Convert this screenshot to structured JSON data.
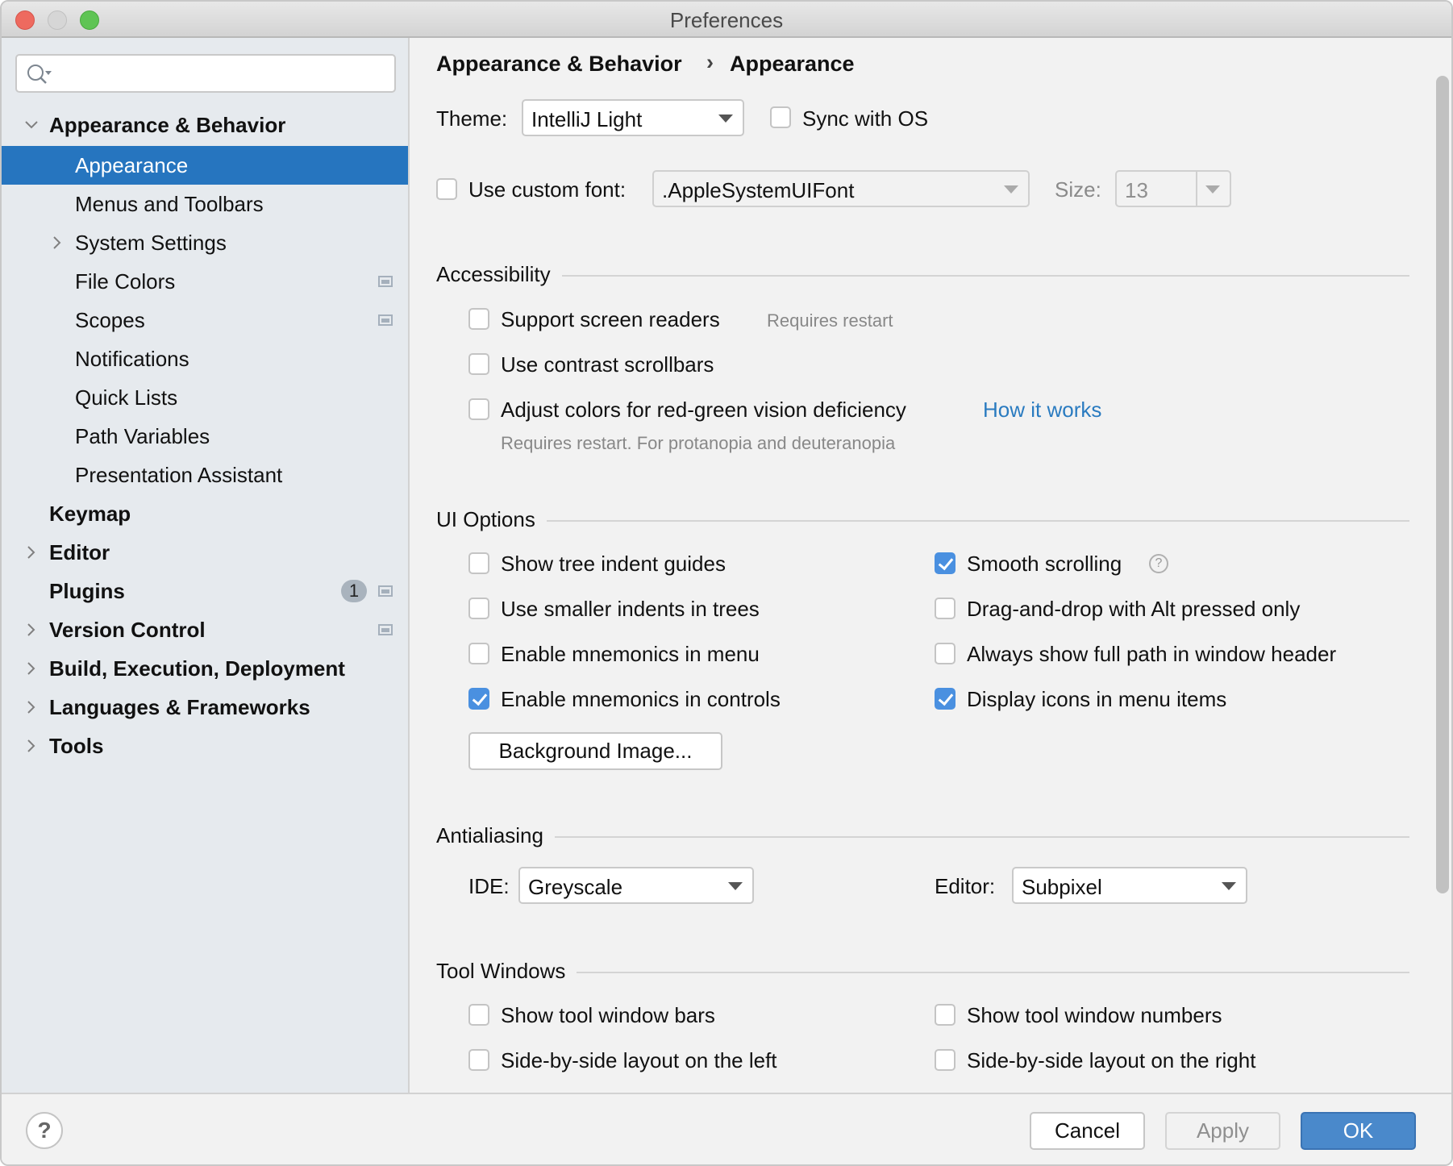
{
  "window": {
    "title": "Preferences"
  },
  "sidebar": {
    "search": {
      "placeholder": "",
      "value": ""
    },
    "items": [
      {
        "label": "Appearance & Behavior",
        "level": 0,
        "bold": true,
        "expander": "expanded"
      },
      {
        "label": "Appearance",
        "level": 1,
        "bold": false,
        "selected": true
      },
      {
        "label": "Menus and Toolbars",
        "level": 1,
        "bold": false
      },
      {
        "label": "System Settings",
        "level": 1,
        "bold": false,
        "expander": "collapsed"
      },
      {
        "label": "File Colors",
        "level": 1,
        "bold": false,
        "project_icon": true
      },
      {
        "label": "Scopes",
        "level": 1,
        "bold": false,
        "project_icon": true
      },
      {
        "label": "Notifications",
        "level": 1,
        "bold": false
      },
      {
        "label": "Quick Lists",
        "level": 1,
        "bold": false
      },
      {
        "label": "Path Variables",
        "level": 1,
        "bold": false
      },
      {
        "label": "Presentation Assistant",
        "level": 1,
        "bold": false
      },
      {
        "label": "Keymap",
        "level": 0,
        "bold": true
      },
      {
        "label": "Editor",
        "level": 0,
        "bold": true,
        "expander": "collapsed"
      },
      {
        "label": "Plugins",
        "level": 0,
        "bold": true,
        "badge": "1",
        "project_icon": true
      },
      {
        "label": "Version Control",
        "level": 0,
        "bold": true,
        "expander": "collapsed",
        "project_icon": true
      },
      {
        "label": "Build, Execution, Deployment",
        "level": 0,
        "bold": true,
        "expander": "collapsed"
      },
      {
        "label": "Languages & Frameworks",
        "level": 0,
        "bold": true,
        "expander": "collapsed"
      },
      {
        "label": "Tools",
        "level": 0,
        "bold": true,
        "expander": "collapsed"
      }
    ]
  },
  "breadcrumb": {
    "parent": "Appearance & Behavior",
    "separator": "›",
    "current": "Appearance"
  },
  "theme": {
    "label": "Theme:",
    "value": "IntelliJ Light",
    "sync_label": "Sync with OS",
    "sync_checked": false
  },
  "font": {
    "use_custom_label": "Use custom font:",
    "use_custom_checked": false,
    "font_value": ".AppleSystemUIFont",
    "size_label": "Size:",
    "size_value": "13"
  },
  "accessibility": {
    "title": "Accessibility",
    "screen_readers": {
      "label": "Support screen readers",
      "checked": false,
      "hint": "Requires restart"
    },
    "contrast_scrollbars": {
      "label": "Use contrast scrollbars",
      "checked": false
    },
    "color_deficiency": {
      "label": "Adjust colors for red-green vision deficiency",
      "checked": false,
      "link": "How it works",
      "hint": "Requires restart. For protanopia and deuteranopia"
    }
  },
  "ui_options": {
    "title": "UI Options",
    "left": [
      {
        "label": "Show tree indent guides",
        "checked": false
      },
      {
        "label": "Use smaller indents in trees",
        "checked": false
      },
      {
        "label": "Enable mnemonics in menu",
        "checked": false
      },
      {
        "label": "Enable mnemonics in controls",
        "checked": true
      }
    ],
    "right": [
      {
        "label": "Smooth scrolling",
        "checked": true,
        "help": "?"
      },
      {
        "label": "Drag-and-drop with Alt pressed only",
        "checked": false
      },
      {
        "label": "Always show full path in window header",
        "checked": false
      },
      {
        "label": "Display icons in menu items",
        "checked": true
      }
    ],
    "background_image_button": "Background Image..."
  },
  "antialiasing": {
    "title": "Antialiasing",
    "ide_label": "IDE:",
    "ide_value": "Greyscale",
    "editor_label": "Editor:",
    "editor_value": "Subpixel"
  },
  "tool_windows": {
    "title": "Tool Windows",
    "left": [
      {
        "label": "Show tool window bars",
        "checked": false
      },
      {
        "label": "Side-by-side layout on the left",
        "checked": false
      }
    ],
    "right": [
      {
        "label": "Show tool window numbers",
        "checked": false
      },
      {
        "label": "Side-by-side layout on the right",
        "checked": false
      }
    ]
  },
  "footer": {
    "help": "?",
    "cancel": "Cancel",
    "apply": "Apply",
    "ok": "OK"
  },
  "colors": {
    "selection": "#2675bf",
    "checkbox_checked": "#4a90e0",
    "link": "#2a7bc0",
    "primary_button": "#4a89cb",
    "sidebar_bg": "#e6eaee",
    "content_bg": "#f2f2f2"
  }
}
